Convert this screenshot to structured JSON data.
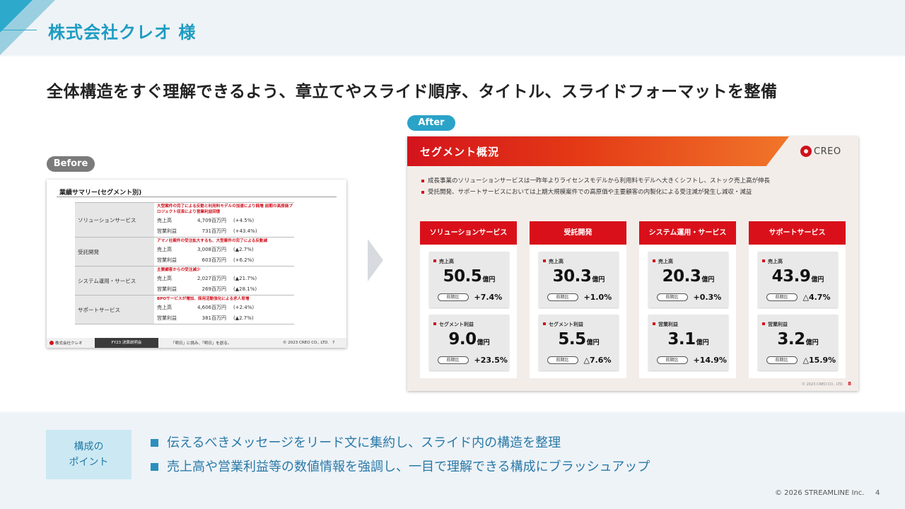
{
  "header": {
    "client": "株式会社クレオ 様"
  },
  "headline": "全体構造をすぐ理解できるよう、章立てやスライド順序、タイトル、スライドフォーマットを整備",
  "labels": {
    "before": "Before",
    "after": "After"
  },
  "before": {
    "title": "業績サマリー(セグメント別)",
    "segments": [
      {
        "name": "ソリューションサービス",
        "note": "大型案件の完了による反動と利用料モデルの加速により鈍増 前期の高原価プロジェクト収束により営業利益回復",
        "rows": [
          {
            "label": "売上高",
            "value": "4,709百万円",
            "change": "(+4.5%)"
          },
          {
            "label": "営業利益",
            "value": "731百万円",
            "change": "(+43.4%)"
          }
        ]
      },
      {
        "name": "受託開発",
        "note": "アマノ社案件の受注拡大するも、大型案件の完了による反動減",
        "rows": [
          {
            "label": "売上高",
            "value": "3,008百万円",
            "change": "(▲2.7%)"
          },
          {
            "label": "営業利益",
            "value": "603百万円",
            "change": "(+6.2%)"
          }
        ]
      },
      {
        "name": "システム運用・サービス",
        "note": "主要顧客からの受注減少",
        "rows": [
          {
            "label": "売上高",
            "value": "2,027百万円",
            "change": "(▲21.7%)"
          },
          {
            "label": "営業利益",
            "value": "269百万円",
            "change": "(▲28.1%)"
          }
        ]
      },
      {
        "name": "サポートサービス",
        "note": "BPOサービスが増加、採用活動強化による求人育増",
        "rows": [
          {
            "label": "売上高",
            "value": "4,606百万円",
            "change": "(+2.4%)"
          },
          {
            "label": "営業利益",
            "value": "381百万円",
            "change": "(▲2.7%)"
          }
        ]
      }
    ],
    "footer": {
      "company": "株式会社クレオ",
      "event": "FY23 決算説明会",
      "message": "「明日」に挑み、「明日」を創る。",
      "copyright": "© 2023 CREO CO., LTD.",
      "page": "7"
    }
  },
  "after": {
    "title": "セグメント概況",
    "logo": "CREO",
    "bullets": [
      "成長事業のソリューションサービスは一昨年よりライセンスモデルから利用料モデルへ大きくシフトし、ストック売上高が伸長",
      "受託開発、サポートサービスにおいては上期大規模案件での高原価や主要顧客の内製化による受注減が発生し減収・減益"
    ],
    "yoy_tag": "前期比",
    "unit": "億円",
    "segments": [
      {
        "name": "ソリューションサービス",
        "metrics": [
          {
            "label": "売上高",
            "value": "50.5",
            "change": "+7.4%"
          },
          {
            "label": "セグメント利益",
            "value": "9.0",
            "change": "+23.5%"
          }
        ]
      },
      {
        "name": "受託開発",
        "metrics": [
          {
            "label": "売上高",
            "value": "30.3",
            "change": "+1.0%"
          },
          {
            "label": "セグメント利益",
            "value": "5.5",
            "change": "△7.6%"
          }
        ]
      },
      {
        "name": "システム運用・サービス",
        "metrics": [
          {
            "label": "売上高",
            "value": "20.3",
            "change": "+0.3%"
          },
          {
            "label": "営業利益",
            "value": "3.1",
            "change": "+14.9%"
          }
        ]
      },
      {
        "name": "サポートサービス",
        "metrics": [
          {
            "label": "売上高",
            "value": "43.9",
            "change": "△4.7%"
          },
          {
            "label": "営業利益",
            "value": "3.2",
            "change": "△15.9%"
          }
        ]
      }
    ],
    "footer": {
      "copyright": "© 2023 CREO CO., LTD.",
      "page": "8"
    }
  },
  "points": {
    "label_line1": "構成の",
    "label_line2": "ポイント",
    "items": [
      "伝えるべきメッセージをリード文に集約し、スライド内の構造を整理",
      "売上高や営業利益等の数値情報を強調し、一目で理解できる構成にブラッシュアップ"
    ]
  },
  "footer": {
    "copyright": "© 2026 STREAMLINE Inc.",
    "page": "4"
  }
}
